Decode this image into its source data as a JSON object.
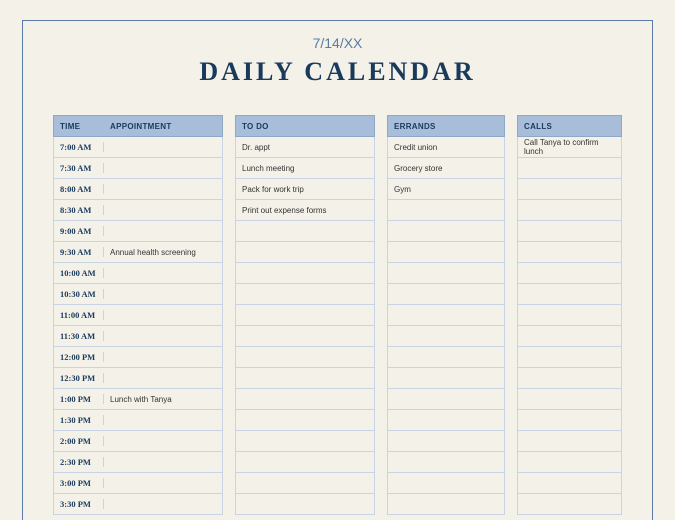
{
  "date": "7/14/XX",
  "title": "DAILY CALENDAR",
  "headers": {
    "time": "TIME",
    "appointment": "APPOINTMENT",
    "todo": "TO DO",
    "errands": "ERRANDS",
    "calls": "CALLS"
  },
  "time_slots": [
    "7:00 AM",
    "7:30 AM",
    "8:00 AM",
    "8:30 AM",
    "9:00 AM",
    "9:30 AM",
    "10:00 AM",
    "10:30 AM",
    "11:00 AM",
    "11:30 AM",
    "12:00 PM",
    "12:30 PM",
    "1:00 PM",
    "1:30 PM",
    "2:00 PM",
    "2:30 PM",
    "3:00 PM",
    "3:30 PM"
  ],
  "appointments": [
    "",
    "",
    "",
    "",
    "",
    "Annual health screening",
    "",
    "",
    "",
    "",
    "",
    "",
    "Lunch with Tanya",
    "",
    "",
    "",
    "",
    ""
  ],
  "todo": [
    "Dr. appt",
    "Lunch meeting",
    "Pack for work trip",
    "Print out expense forms",
    "",
    "",
    "",
    "",
    "",
    "",
    "",
    "",
    "",
    "",
    "",
    "",
    "",
    ""
  ],
  "errands": [
    "Credit union",
    "Grocery store",
    "Gym",
    "",
    "",
    "",
    "",
    "",
    "",
    "",
    "",
    "",
    "",
    "",
    "",
    "",
    "",
    ""
  ],
  "calls": [
    "Call Tanya to confirm lunch",
    "",
    "",
    "",
    "",
    "",
    "",
    "",
    "",
    "",
    "",
    "",
    "",
    "",
    "",
    "",
    "",
    ""
  ]
}
